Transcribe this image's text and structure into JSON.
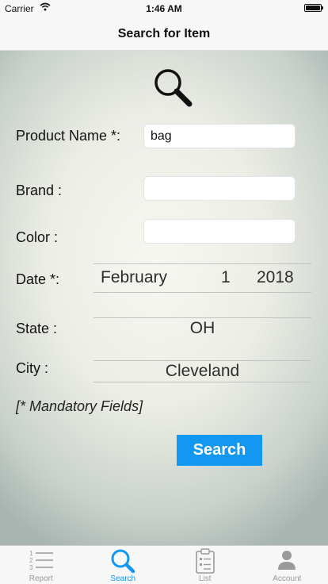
{
  "status_bar": {
    "carrier": "Carrier",
    "time": "1:46 AM",
    "wifi_icon": "wifi-icon",
    "battery_icon": "battery-icon"
  },
  "nav": {
    "title": "Search for Item"
  },
  "hero_icon": "magnifying-glass-icon",
  "form": {
    "product_name": {
      "label": "Product Name *:",
      "value": "bag"
    },
    "brand": {
      "label": "Brand :",
      "value": ""
    },
    "color": {
      "label": "Color :",
      "value": ""
    },
    "date": {
      "label": "Date *:",
      "month": "February",
      "day": "1",
      "year": "2018"
    },
    "state": {
      "label": "State :",
      "value": "OH"
    },
    "city": {
      "label": "City :",
      "value": "Cleveland"
    },
    "mandatory_note": "[* Mandatory Fields]",
    "search_button": "Search"
  },
  "colors": {
    "accent": "#1298f0",
    "tab_inactive": "#9a9a9a"
  },
  "tab_bar": {
    "items": [
      {
        "label": "Report",
        "icon": "numbered-list-icon",
        "active": false
      },
      {
        "label": "Search",
        "icon": "search-icon",
        "active": true
      },
      {
        "label": "List",
        "icon": "clipboard-list-icon",
        "active": false
      },
      {
        "label": "Account",
        "icon": "person-icon",
        "active": false
      }
    ]
  }
}
